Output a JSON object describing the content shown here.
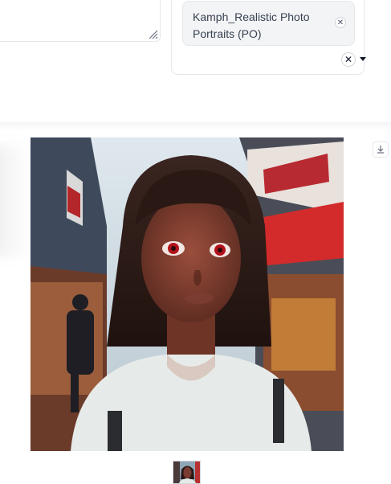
{
  "style_selector": {
    "selected_style": "Kamph_Realistic Photo Portraits (PO)",
    "remove_icon": "close-icon",
    "clear_icon": "close-icon",
    "caret_icon": "caret-down-icon"
  },
  "gallery": {
    "download_icon": "download-icon",
    "thumbnail_count": 1
  }
}
